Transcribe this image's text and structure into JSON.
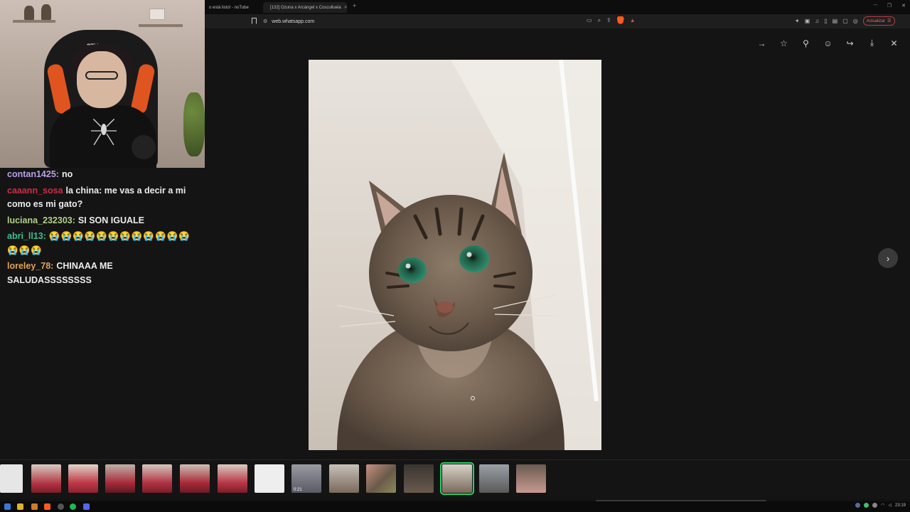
{
  "browser": {
    "tabs": [
      {
        "label": "o está listo! - noTube"
      },
      {
        "label": "[132] Ozuna x Arcángel x Cosculluela"
      }
    ],
    "url": "web.whatsapp.com",
    "update_label": "Actualizar"
  },
  "chat": {
    "messages": [
      {
        "user": "contan1425:",
        "text": "no",
        "user_color": "#b9a0e6"
      },
      {
        "user": "caaann_sosa",
        "text": "la china: me vas a decir a mi como es mi gato?",
        "user_color": "#d02b4a"
      },
      {
        "user": "luciana_232303:",
        "text": "SI SON IGUALE",
        "user_color": "#b2d08a"
      },
      {
        "user": "abri_ll13:",
        "text": "😭😭😭😭😭😭😭😭😭😭😭😭😭😭😭",
        "user_color": "#3fbf8f"
      },
      {
        "user": "loreley_78:",
        "text": "CHINAAA ME SALUDASSSSSSSS",
        "user_color": "#e0a35a"
      }
    ]
  },
  "viewer": {
    "toolbar": [
      {
        "name": "forward-to-chat-icon",
        "glyph": "→"
      },
      {
        "name": "star-icon",
        "glyph": "☆"
      },
      {
        "name": "pin-icon",
        "glyph": "⚲"
      },
      {
        "name": "emoji-react-icon",
        "glyph": "☺"
      },
      {
        "name": "share-icon",
        "glyph": "↪"
      },
      {
        "name": "download-icon",
        "glyph": "⤓"
      },
      {
        "name": "close-icon",
        "glyph": "✕"
      }
    ],
    "next_glyph": "›"
  },
  "thumbnails": {
    "video_duration": "0:21",
    "selected_index": 12
  },
  "taskbar": {
    "clock": "23:19"
  }
}
